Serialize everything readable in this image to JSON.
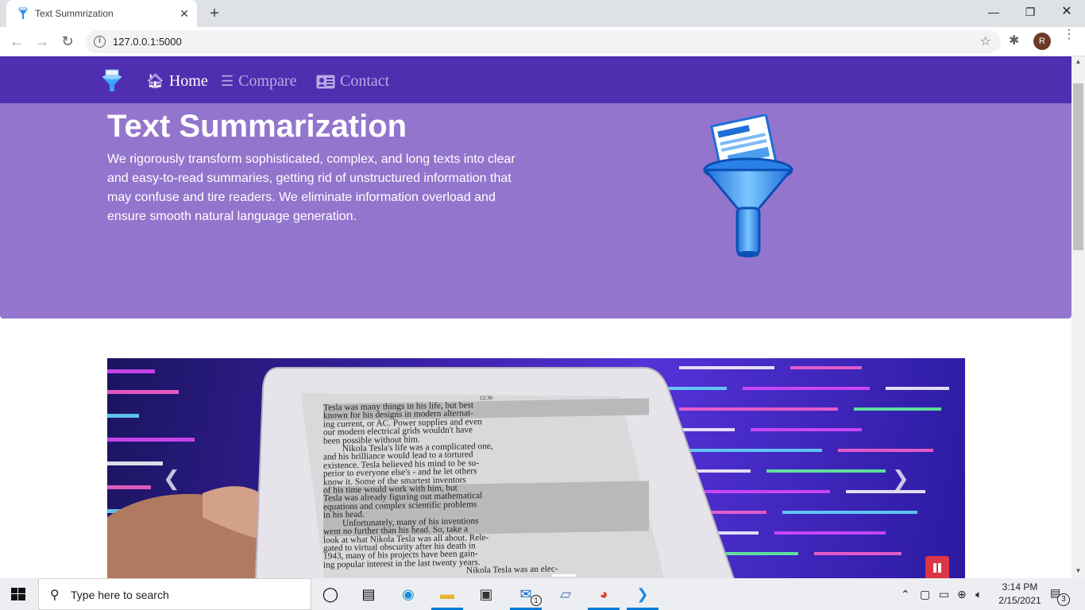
{
  "browser": {
    "tab_title": "Text Summrization",
    "url": "127.0.0.1:5000",
    "profile_initial": "R"
  },
  "site": {
    "nav": [
      {
        "label": "Home",
        "icon": "home-icon"
      },
      {
        "label": "Compare",
        "icon": "list-icon"
      },
      {
        "label": "Contact",
        "icon": "address-card-icon"
      }
    ],
    "hero": {
      "title": "Text Summarization",
      "description": "We rigorously transform sophisticated, complex, and long texts into clear and easy-to-read summaries, getting rid of unstructured information that may confuse and tire readers. We eliminate information overload and ensure smooth natural language generation."
    },
    "carousel": {
      "prev_icon": "chevron-left-icon",
      "next_icon": "chevron-right-icon",
      "pause_icon": "pause-icon",
      "tablet_text": [
        "12:36",
        "Tesla was many things in his life, but best",
        "known for his designs in modern alternat-",
        "ing current, or AC. Power supplies and even",
        "our modern electrical grids wouldn't have",
        "been possible without him.",
        "Nikola Tesla's life was a complicated one,",
        "and his brilliance would lead to a tortured",
        "existence. Tesla believed his mind to be su-",
        "perior to everyone else's - and he let others",
        "know it. Some of the smartest inventors",
        "of his time would work with him, but",
        "Tesla was already figuring out mathematical",
        "equations and complex scientific problems",
        "in his head.",
        "Unfortunately, many of his inventions",
        "went no further than his head. So, take a",
        "look at what Nikola Tesla was all about. Rele-",
        "gated to virtual obscurity after his death in",
        "1943, many of his projects have been gain-",
        "ing popular interest in the last twenty years.",
        "Nikola Tesla was an elec-"
      ]
    },
    "colors": {
      "navbar": "#502eb0",
      "hero": "#9475cd",
      "pause": "#dc3545"
    }
  },
  "taskbar": {
    "search_placeholder": "Type here to search",
    "time": "3:14 PM",
    "date": "2/15/2021",
    "mail_badge": "1",
    "notification_count": "3"
  }
}
